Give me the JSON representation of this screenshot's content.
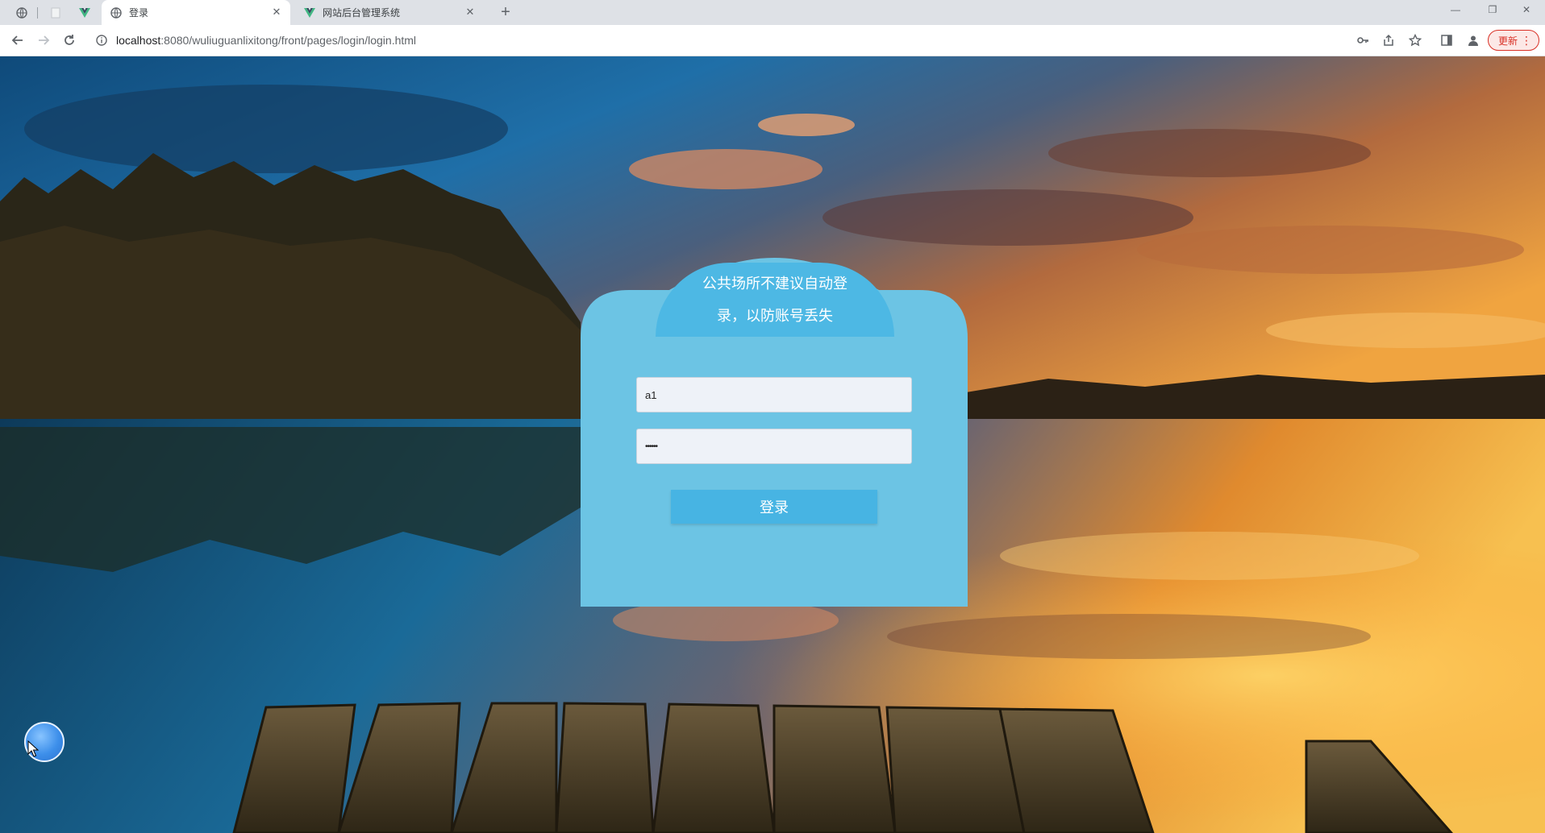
{
  "browser": {
    "tabs": [
      {
        "pinned": true,
        "icon": "globe-icon",
        "title": ""
      },
      {
        "pinned": true,
        "icon": "blank-icon",
        "title": ""
      },
      {
        "pinned": true,
        "icon": "vue-icon",
        "title": ""
      },
      {
        "pinned": false,
        "active": true,
        "icon": "globe-icon",
        "title": "登录"
      },
      {
        "pinned": false,
        "active": false,
        "icon": "vue-icon",
        "title": "网站后台管理系统"
      }
    ],
    "new_tab_icon": "plus-icon",
    "close_icon": "close-icon",
    "window_controls": [
      "minimize-icon",
      "restore-icon",
      "close-icon"
    ],
    "address_bar": {
      "url_host": "localhost",
      "url_rest": ":8080/wuliuguanlixitong/front/pages/login/login.html",
      "security_icon": "info-icon"
    },
    "toolbar_icons": [
      "key-icon",
      "share-icon",
      "star-icon",
      "sidebar-icon",
      "profile-icon"
    ],
    "update_button": {
      "label": "更新",
      "icon": "kebab-menu-icon",
      "color": "#d93025"
    }
  },
  "login": {
    "notice_line1": "公共场所不建议自动登",
    "notice_line2": "录，以防账号丢失",
    "username_value": "a1",
    "password_value": "••••••",
    "submit_label": "登录",
    "card_color": "#6cc4e4",
    "notice_color": "#4db8e4",
    "button_color": "#47b4e3"
  },
  "floating_widget": {
    "icon": "assistive-ball-icon"
  },
  "colors": {
    "chrome_bg": "#dee1e6",
    "toolbar_bg": "#ffffff",
    "accent": "#4db8e4"
  }
}
